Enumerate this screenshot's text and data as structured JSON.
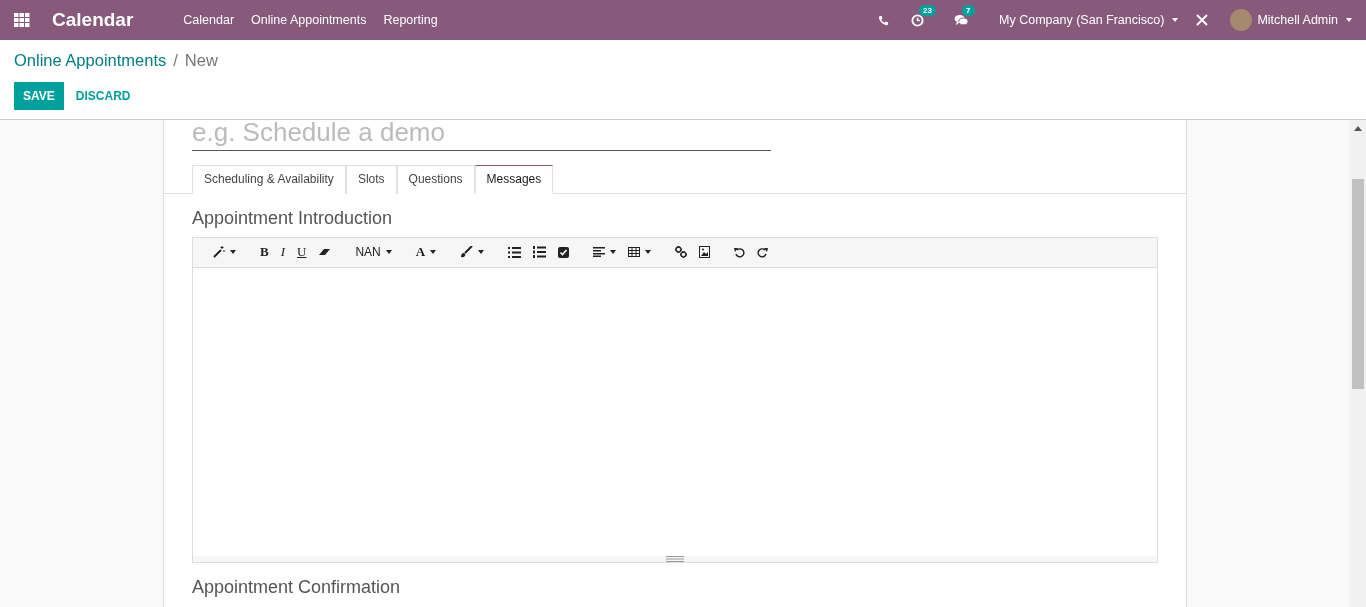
{
  "navbar": {
    "app_title": "Calendar",
    "menu": [
      {
        "label": "Calendar"
      },
      {
        "label": "Online Appointments"
      },
      {
        "label": "Reporting"
      }
    ],
    "activity_count": "23",
    "message_count": "7",
    "company": "My Company (San Francisco)",
    "user": "Mitchell Admin"
  },
  "breadcrumb": {
    "parent": "Online Appointments",
    "separator": "/",
    "current": "New"
  },
  "buttons": {
    "save": "SAVE",
    "discard": "DISCARD"
  },
  "form": {
    "name_placeholder": "e.g. Schedule a demo",
    "tabs": [
      {
        "label": "Scheduling & Availability",
        "selected": false
      },
      {
        "label": "Slots",
        "selected": false
      },
      {
        "label": "Questions",
        "selected": false
      },
      {
        "label": "Messages",
        "selected": true
      }
    ],
    "intro_title": "Appointment Introduction",
    "confirmation_title": "Appointment Confirmation",
    "toolbar": [
      {
        "kind": "magic"
      },
      {
        "kind": "bold",
        "label": "B"
      },
      {
        "kind": "italic",
        "label": "I"
      },
      {
        "kind": "underline",
        "label": "U"
      },
      {
        "kind": "eraser"
      },
      {
        "kind": "fontsize",
        "label": "NAN"
      },
      {
        "kind": "fontcolor",
        "label": "A"
      },
      {
        "kind": "brush"
      },
      {
        "kind": "bullets"
      },
      {
        "kind": "numbers"
      },
      {
        "kind": "checklist"
      },
      {
        "kind": "align"
      },
      {
        "kind": "table"
      },
      {
        "kind": "link"
      },
      {
        "kind": "image"
      },
      {
        "kind": "undo"
      },
      {
        "kind": "redo"
      }
    ]
  }
}
